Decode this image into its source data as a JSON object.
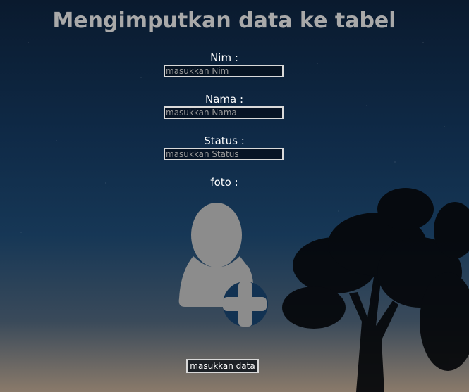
{
  "page": {
    "title": "Mengimputkan data ke tabel"
  },
  "form": {
    "nim_label": "Nim :",
    "nim_placeholder": "masukkan Nim",
    "nama_label": "Nama :",
    "nama_placeholder": "masukkan Nama",
    "status_label": "Status :",
    "status_placeholder": "masukkan Status",
    "foto_label": "foto :",
    "photo_icon": "add-user-icon",
    "submit_label": "masukkan data"
  },
  "colors": {
    "title": "#a9a9a9",
    "label": "#ffffff",
    "input_border": "#d9d9d9",
    "icon_gray": "#8c8c8c",
    "sky_top": "#0a1a2e"
  }
}
